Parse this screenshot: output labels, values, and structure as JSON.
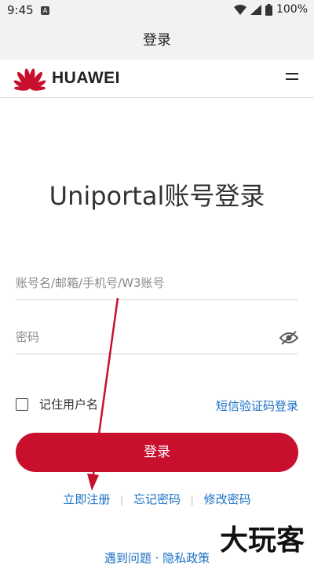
{
  "statusbar": {
    "time": "9:45",
    "battery": "100%"
  },
  "titlebar": {
    "title": "登录"
  },
  "brand": {
    "name": "HUAWEI",
    "color": "#c8102e"
  },
  "login": {
    "heading": "Uniportal账号登录",
    "account_placeholder": "账号名/邮箱/手机号/W3账号",
    "password_placeholder": "密码",
    "remember_label": "记住用户名",
    "sms_login": "短信验证码登录",
    "submit_label": "登录"
  },
  "links": {
    "register": "立即注册",
    "forgot": "忘记密码",
    "change": "修改密码",
    "separator": "|"
  },
  "bottom_links": {
    "text": "遇到问题 · 隐私政策"
  },
  "watermark": "大玩客",
  "colors": {
    "primary": "#c8102e",
    "link": "#1a6fc4"
  },
  "icons": [
    "menu-icon",
    "eye-off-icon",
    "wifi-icon",
    "signal-icon",
    "battery-icon"
  ]
}
